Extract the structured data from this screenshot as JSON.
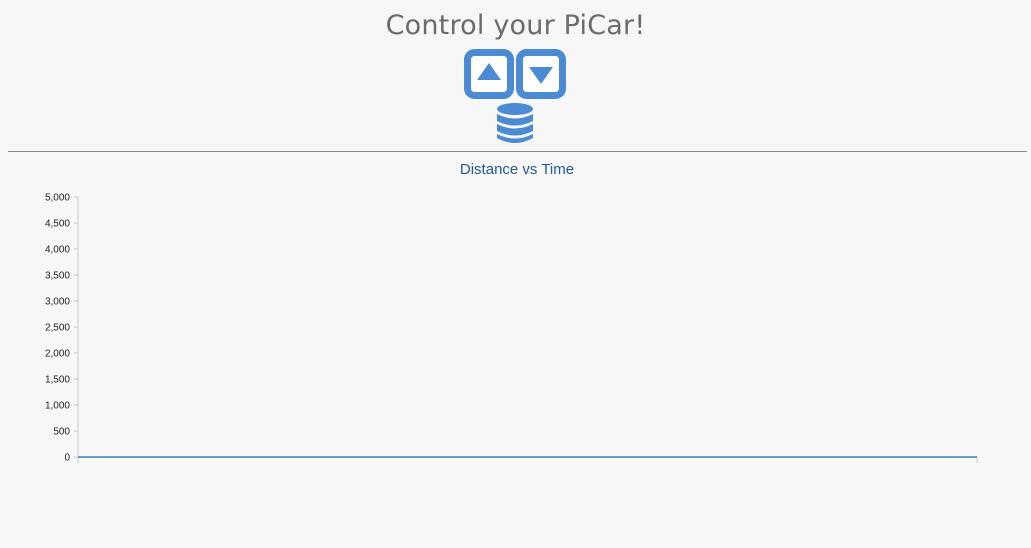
{
  "header": {
    "title": "Control your PiCar!"
  },
  "controls": {
    "forward_icon": "arrow-up-box-icon",
    "backward_icon": "arrow-down-box-icon",
    "data_icon": "database-icon",
    "accent_color": "#4a8bd4"
  },
  "chart_data": {
    "type": "line",
    "title": "Distance vs Time",
    "xlabel": "",
    "ylabel": "",
    "ylim": [
      0,
      5000
    ],
    "y_ticks": [
      "0",
      "500",
      "1,000",
      "1,500",
      "2,000",
      "2,500",
      "3,000",
      "3,500",
      "4,000",
      "4,500",
      "5,000"
    ],
    "grid": false,
    "series": [
      {
        "values": [
          0,
          0
        ]
      }
    ],
    "title_color": "#1f5a99",
    "line_color": "#4a7fbf"
  }
}
